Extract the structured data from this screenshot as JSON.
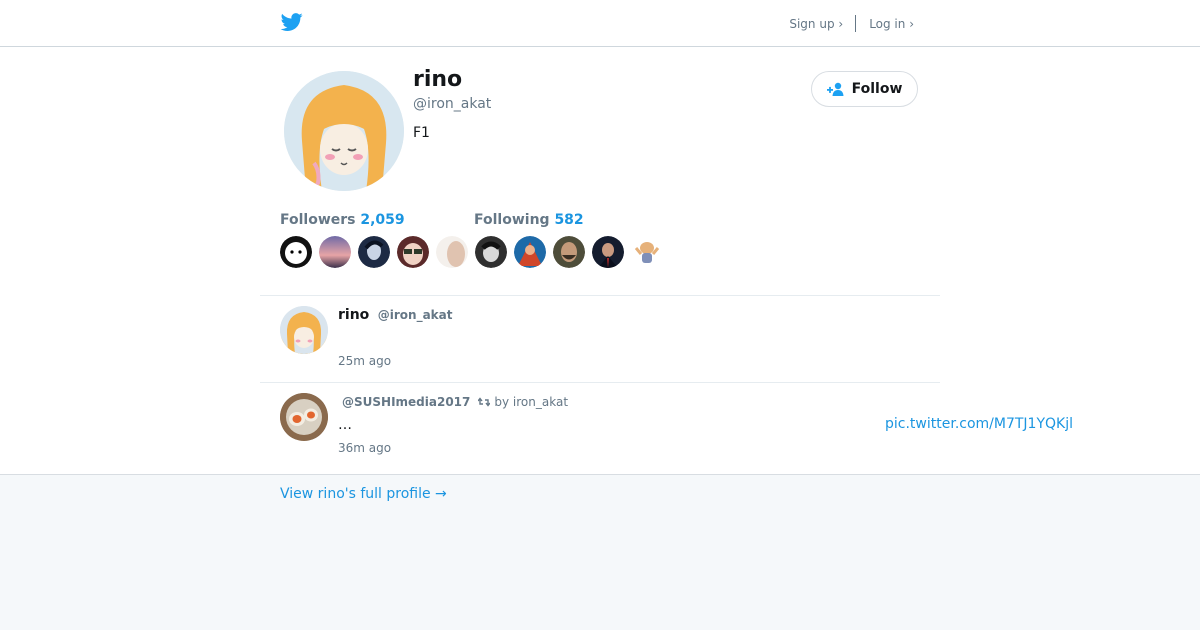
{
  "topbar": {
    "logo": "twitter-bird-icon",
    "signup_label": "Sign up ›",
    "login_label": "Log in ›"
  },
  "profile": {
    "name": "rino",
    "handle": "@iron_akat",
    "bio": "F1",
    "follow_label": "Follow",
    "followers_label": "Followers",
    "followers_count": "2,059",
    "following_label": "Following",
    "following_count": "582",
    "avatar_colors": [
      "#f0b85a",
      "#d9e6ef",
      "#f6ead9"
    ]
  },
  "mini_avatars": [
    {
      "name": "mini-avatar-1",
      "color": "#ffffff"
    },
    {
      "name": "mini-avatar-2",
      "color": "#8f7ca0"
    },
    {
      "name": "mini-avatar-3",
      "color": "#1f2d4a"
    },
    {
      "name": "mini-avatar-4",
      "color": "#5a2b2b"
    },
    {
      "name": "mini-avatar-5",
      "color": "#e7d6c6"
    },
    {
      "name": "mini-avatar-6",
      "color": "#3a3a3a"
    },
    {
      "name": "mini-avatar-7",
      "color": "#c84f2a"
    },
    {
      "name": "mini-avatar-8",
      "color": "#5e5c45"
    },
    {
      "name": "mini-avatar-9",
      "color": "#152036"
    },
    {
      "name": "mini-avatar-10",
      "color": "#f2d3b6"
    }
  ],
  "tweets": [
    {
      "name": "rino",
      "handle": "@iron_akat",
      "time": "25m ago"
    },
    {
      "handle": "@SUSHImedia2017",
      "retweet_by": "by iron_akat",
      "text": "…",
      "link": "pic.twitter.com/M7TJ1YQKjl",
      "time": "36m ago"
    }
  ],
  "footer": {
    "full_profile_label": "View rino's full profile →"
  }
}
